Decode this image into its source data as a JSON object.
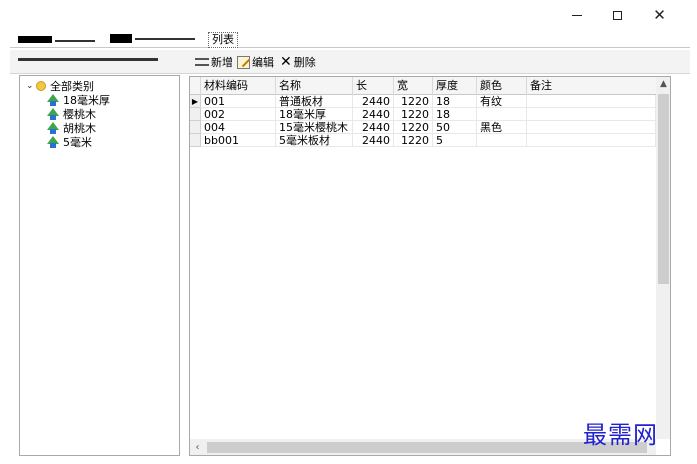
{
  "window": {
    "minimize": "",
    "maximize": "",
    "close": "✕"
  },
  "tabs": {
    "active_label": "列表"
  },
  "toolbar": {
    "add_label": "新增",
    "edit_label": "编辑",
    "delete_label": "删除"
  },
  "tree": {
    "root": "全部类别",
    "children": [
      "18毫米厚",
      "樱桃木",
      "胡桃木",
      "5毫米"
    ]
  },
  "grid": {
    "columns": [
      "材料编码",
      "名称",
      "长",
      "宽",
      "厚度",
      "颜色",
      "备注"
    ],
    "rows": [
      [
        "001",
        "普通板材",
        "2440",
        "1220",
        "18",
        "有纹",
        ""
      ],
      [
        "002",
        "18毫米厚",
        "2440",
        "1220",
        "18",
        "",
        ""
      ],
      [
        "004",
        "15毫米樱桃木",
        "2440",
        "1220",
        "50",
        "黑色",
        ""
      ],
      [
        "bb001",
        "5毫米板材",
        "2440",
        "1220",
        "5",
        "",
        ""
      ]
    ]
  },
  "watermark": "最需网",
  "colors": {
    "watermark": "#2222cc",
    "folder": "#f3c745"
  }
}
